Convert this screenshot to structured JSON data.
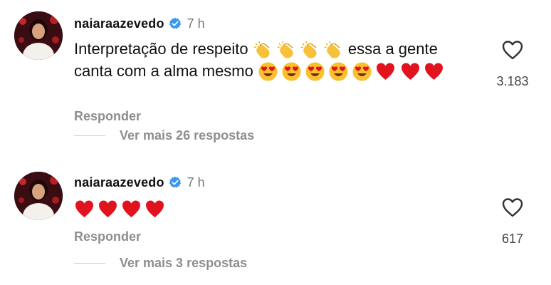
{
  "comments": [
    {
      "username": "naiaraazevedo",
      "time": "7 h",
      "text_before": "Interpretação de respeito",
      "text_after": "essa a gente canta com a alma mesmo",
      "reply_label": "Responder",
      "more_replies": "Ver mais 26 respostas",
      "like_count": "3.183"
    },
    {
      "username": "naiaraazevedo",
      "time": "7 h",
      "reply_label": "Responder",
      "more_replies": "Ver mais 3 respostas",
      "like_count": "617"
    }
  ],
  "colors": {
    "verified_blue": "#3897f0",
    "muted_text": "#8e8e8e",
    "heart_red": "#e0131f"
  }
}
